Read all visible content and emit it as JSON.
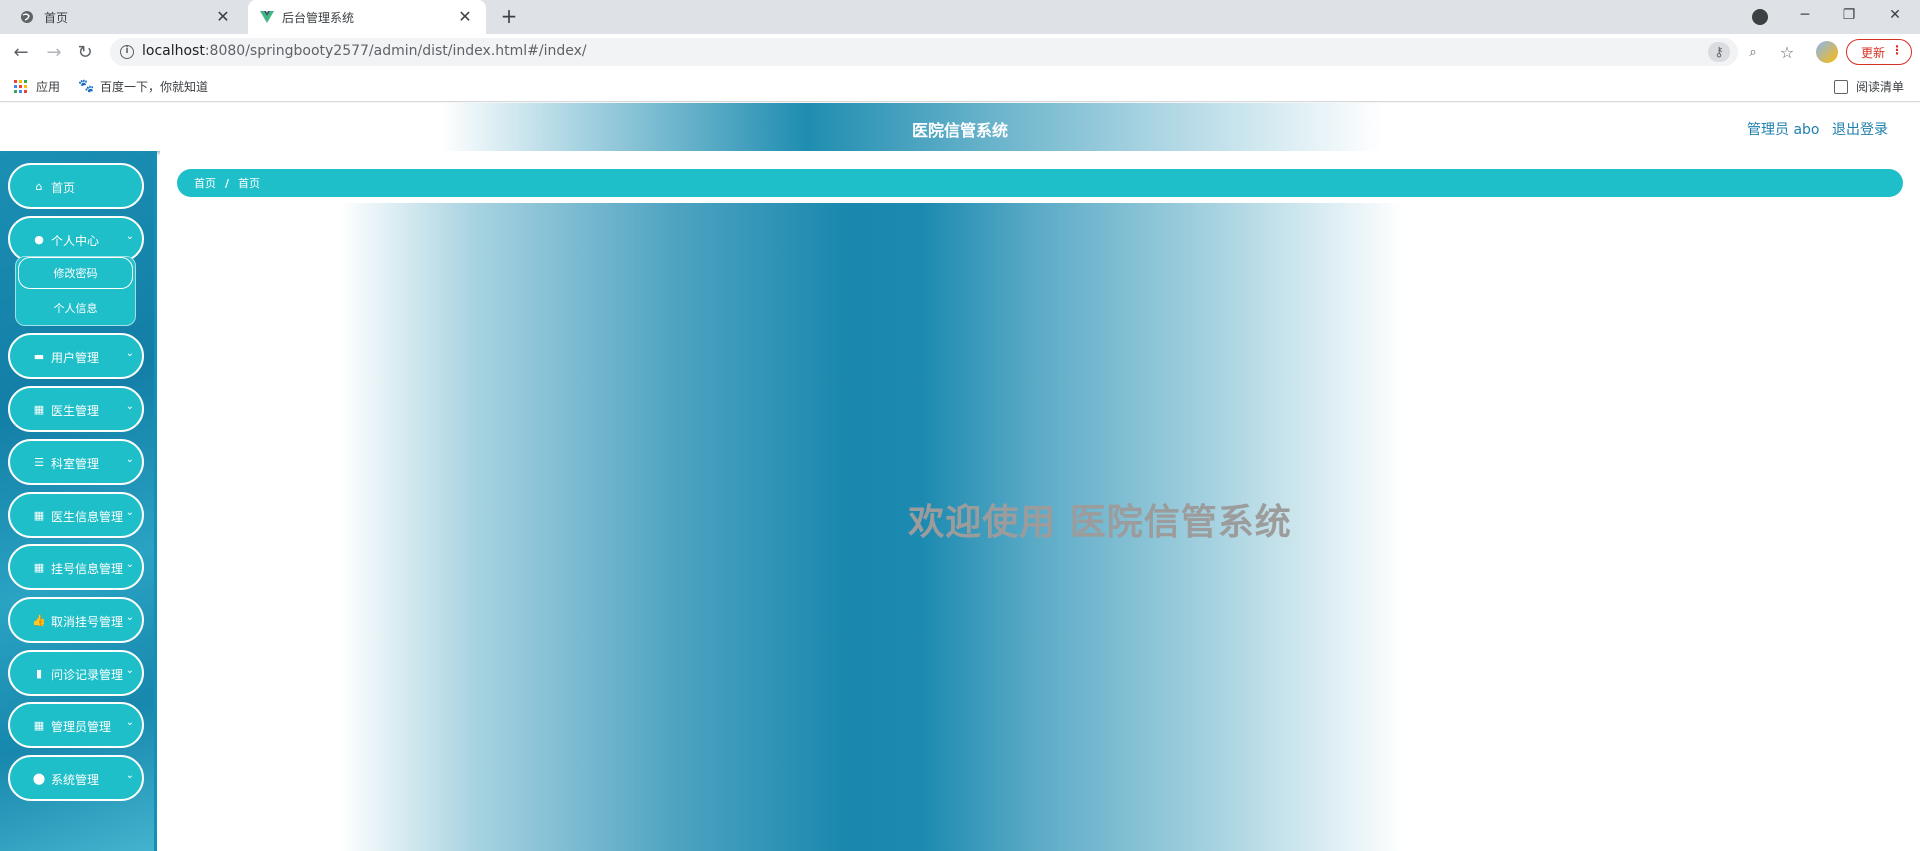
{
  "browser": {
    "tabs": [
      {
        "title": "首页",
        "active": false
      },
      {
        "title": "后台管理系统",
        "active": true
      }
    ],
    "new_tab": "+",
    "url_host": "localhost",
    "url_rest": ":8080/springbooty2577/admin/dist/index.html#/index/",
    "update_label": "更新",
    "bookmarks": [
      {
        "label": "应用",
        "icon": "apps-icon"
      },
      {
        "label": "百度一下，你就知道",
        "icon": "baidu-paw-icon"
      }
    ],
    "reading_list": "阅读清单"
  },
  "app": {
    "title": "医院信管系统",
    "user_label": "管理员 abo",
    "logout_label": "退出登录",
    "menu": [
      {
        "label": "首页",
        "icon": "home-icon",
        "expandable": false
      },
      {
        "label": "个人中心",
        "icon": "user-icon",
        "expandable": true
      },
      {
        "label": "用户管理",
        "icon": "comment-icon",
        "expandable": true
      },
      {
        "label": "医生管理",
        "icon": "grid-icon",
        "expandable": true
      },
      {
        "label": "科室管理",
        "icon": "sliders-icon",
        "expandable": true
      },
      {
        "label": "医生信息管理",
        "icon": "grid-icon",
        "expandable": true
      },
      {
        "label": "挂号信息管理",
        "icon": "grid-icon",
        "expandable": true
      },
      {
        "label": "取消挂号管理",
        "icon": "thumb-icon",
        "expandable": true
      },
      {
        "label": "问诊记录管理",
        "icon": "clipboard-icon",
        "expandable": true
      },
      {
        "label": "管理员管理",
        "icon": "grid-icon",
        "expandable": true
      },
      {
        "label": "系统管理",
        "icon": "location-icon",
        "expandable": true
      }
    ],
    "submenu": [
      {
        "label": "修改密码"
      },
      {
        "label": "个人信息"
      }
    ],
    "breadcrumb": [
      "首页",
      "首页"
    ],
    "breadcrumb_sep": "/",
    "welcome": "欢迎使用 医院信管系统"
  },
  "colors": {
    "accent": "#1ebfc9",
    "sidebar": "#1787ad",
    "header_link": "#1f7fad",
    "welcome_text": "#9c9c9c"
  }
}
